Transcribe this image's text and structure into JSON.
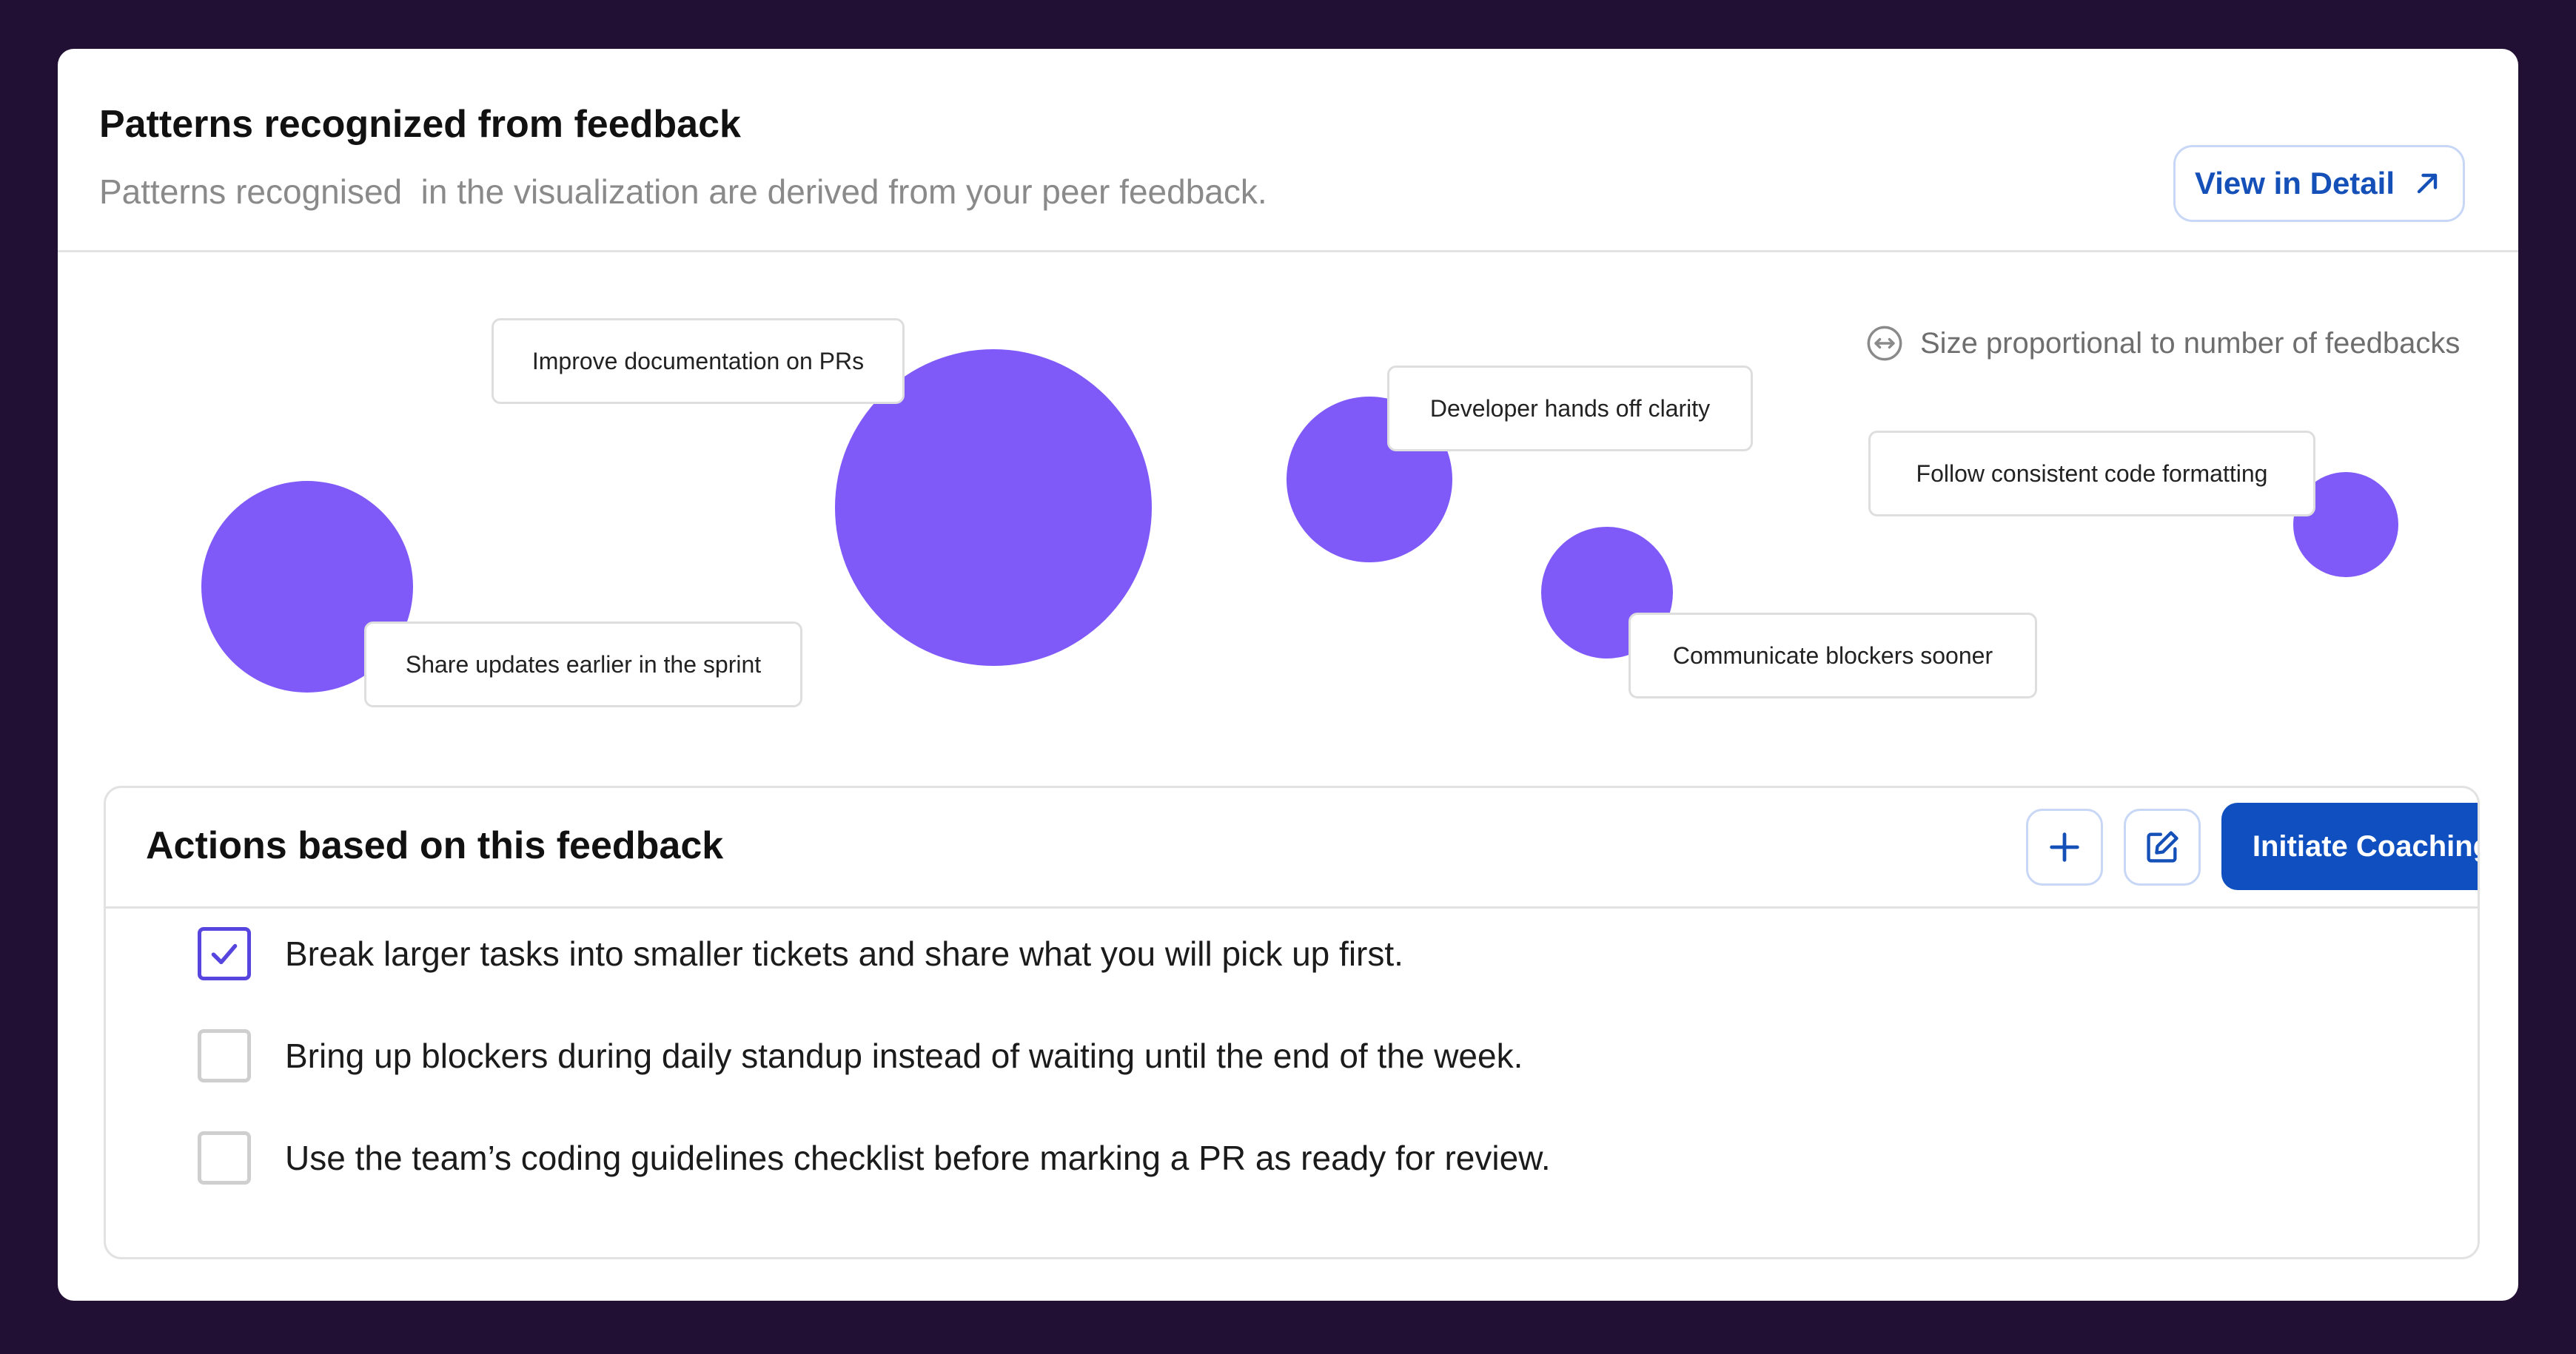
{
  "header": {
    "title": "Patterns recognized from feedback",
    "subtitle": "Patterns recognised  in the visualization are derived from your peer feedback.",
    "view_detail_label": "View in Detail"
  },
  "legend": {
    "text": "Size proportional to number of feedbacks",
    "icon": "resize-horizontal-icon"
  },
  "patterns": [
    {
      "label": "Share updates earlier in the sprint"
    },
    {
      "label": "Improve documentation on PRs"
    },
    {
      "label": "Developer hands off clarity"
    },
    {
      "label": "Communicate blockers sooner"
    },
    {
      "label": "Follow consistent code formatting"
    }
  ],
  "actions": {
    "title": "Actions based on this feedback",
    "add_icon": "plus-icon",
    "edit_icon": "edit-icon",
    "initiate_label": "Initiate Coaching",
    "items": [
      {
        "text": "Break larger tasks into smaller tickets and share what you will pick up first.",
        "checked": true
      },
      {
        "text": "Bring up blockers during daily standup instead of waiting until the end of the week.",
        "checked": false
      },
      {
        "text": "Use the team’s coding guidelines checklist before marking a PR as ready for review.",
        "checked": false
      }
    ]
  },
  "colors": {
    "background": "#211034",
    "bubble": "#7f5af8",
    "primary": "#0f4fbf",
    "checkbox_checked": "#5745e0"
  }
}
